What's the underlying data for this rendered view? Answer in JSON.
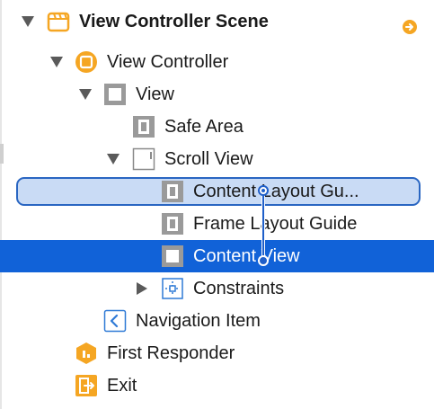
{
  "outline": {
    "items": [
      {
        "label": "View Controller Scene",
        "icon": "scene-icon",
        "disclosure": "expanded"
      },
      {
        "label": "View Controller",
        "icon": "view-controller-icon",
        "disclosure": "expanded"
      },
      {
        "label": "View",
        "icon": "view-icon",
        "disclosure": "expanded"
      },
      {
        "label": "Safe Area",
        "icon": "layout-guide-icon",
        "disclosure": "none"
      },
      {
        "label": "Scroll View",
        "icon": "scroll-view-icon",
        "disclosure": "expanded"
      },
      {
        "label": "Content Layout Gu...",
        "icon": "layout-guide-icon",
        "disclosure": "none",
        "state": "drop-target"
      },
      {
        "label": "Frame Layout Guide",
        "icon": "layout-guide-icon",
        "disclosure": "none"
      },
      {
        "label": "Content View",
        "icon": "view-icon",
        "disclosure": "none",
        "state": "selected"
      },
      {
        "label": "Constraints",
        "icon": "constraints-icon",
        "disclosure": "collapsed"
      },
      {
        "label": "Navigation Item",
        "icon": "navigation-item-icon",
        "disclosure": "none"
      },
      {
        "label": "First Responder",
        "icon": "first-responder-icon",
        "disclosure": "none"
      },
      {
        "label": "Exit",
        "icon": "exit-icon",
        "disclosure": "none"
      }
    ]
  },
  "colors": {
    "selection": "#1162d8",
    "drop_target_fill": "#c9dbf5",
    "drop_target_border": "#2a66c2",
    "accent_orange": "#f5a623",
    "icon_gray": "#8a8a8a"
  }
}
